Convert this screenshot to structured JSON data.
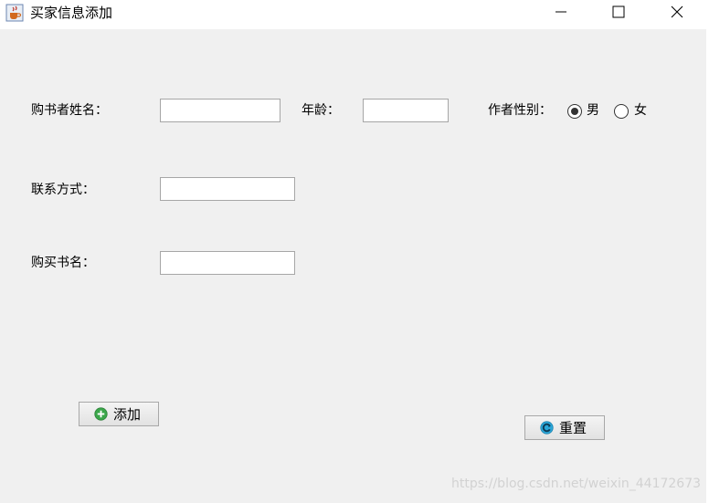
{
  "window": {
    "title": "买家信息添加",
    "icons": {
      "app": "java-cup-icon",
      "minimize": "minimize-icon",
      "maximize": "maximize-icon",
      "close": "close-icon"
    }
  },
  "form": {
    "buyer_name_label": "购书者姓名：",
    "buyer_name_value": "",
    "age_label": "年龄：",
    "age_value": "",
    "gender_label": "作者性别：",
    "gender_options": [
      "男",
      "女"
    ],
    "gender_selected": "男",
    "contact_label": "联系方式：",
    "contact_value": "",
    "book_name_label": "购买书名：",
    "book_name_value": ""
  },
  "buttons": {
    "add_label": "添加",
    "add_icon": "add-circle-icon",
    "reset_label": "重置",
    "reset_icon": "reset-icon"
  },
  "watermark": "https://blog.csdn.net/weixin_44172673"
}
